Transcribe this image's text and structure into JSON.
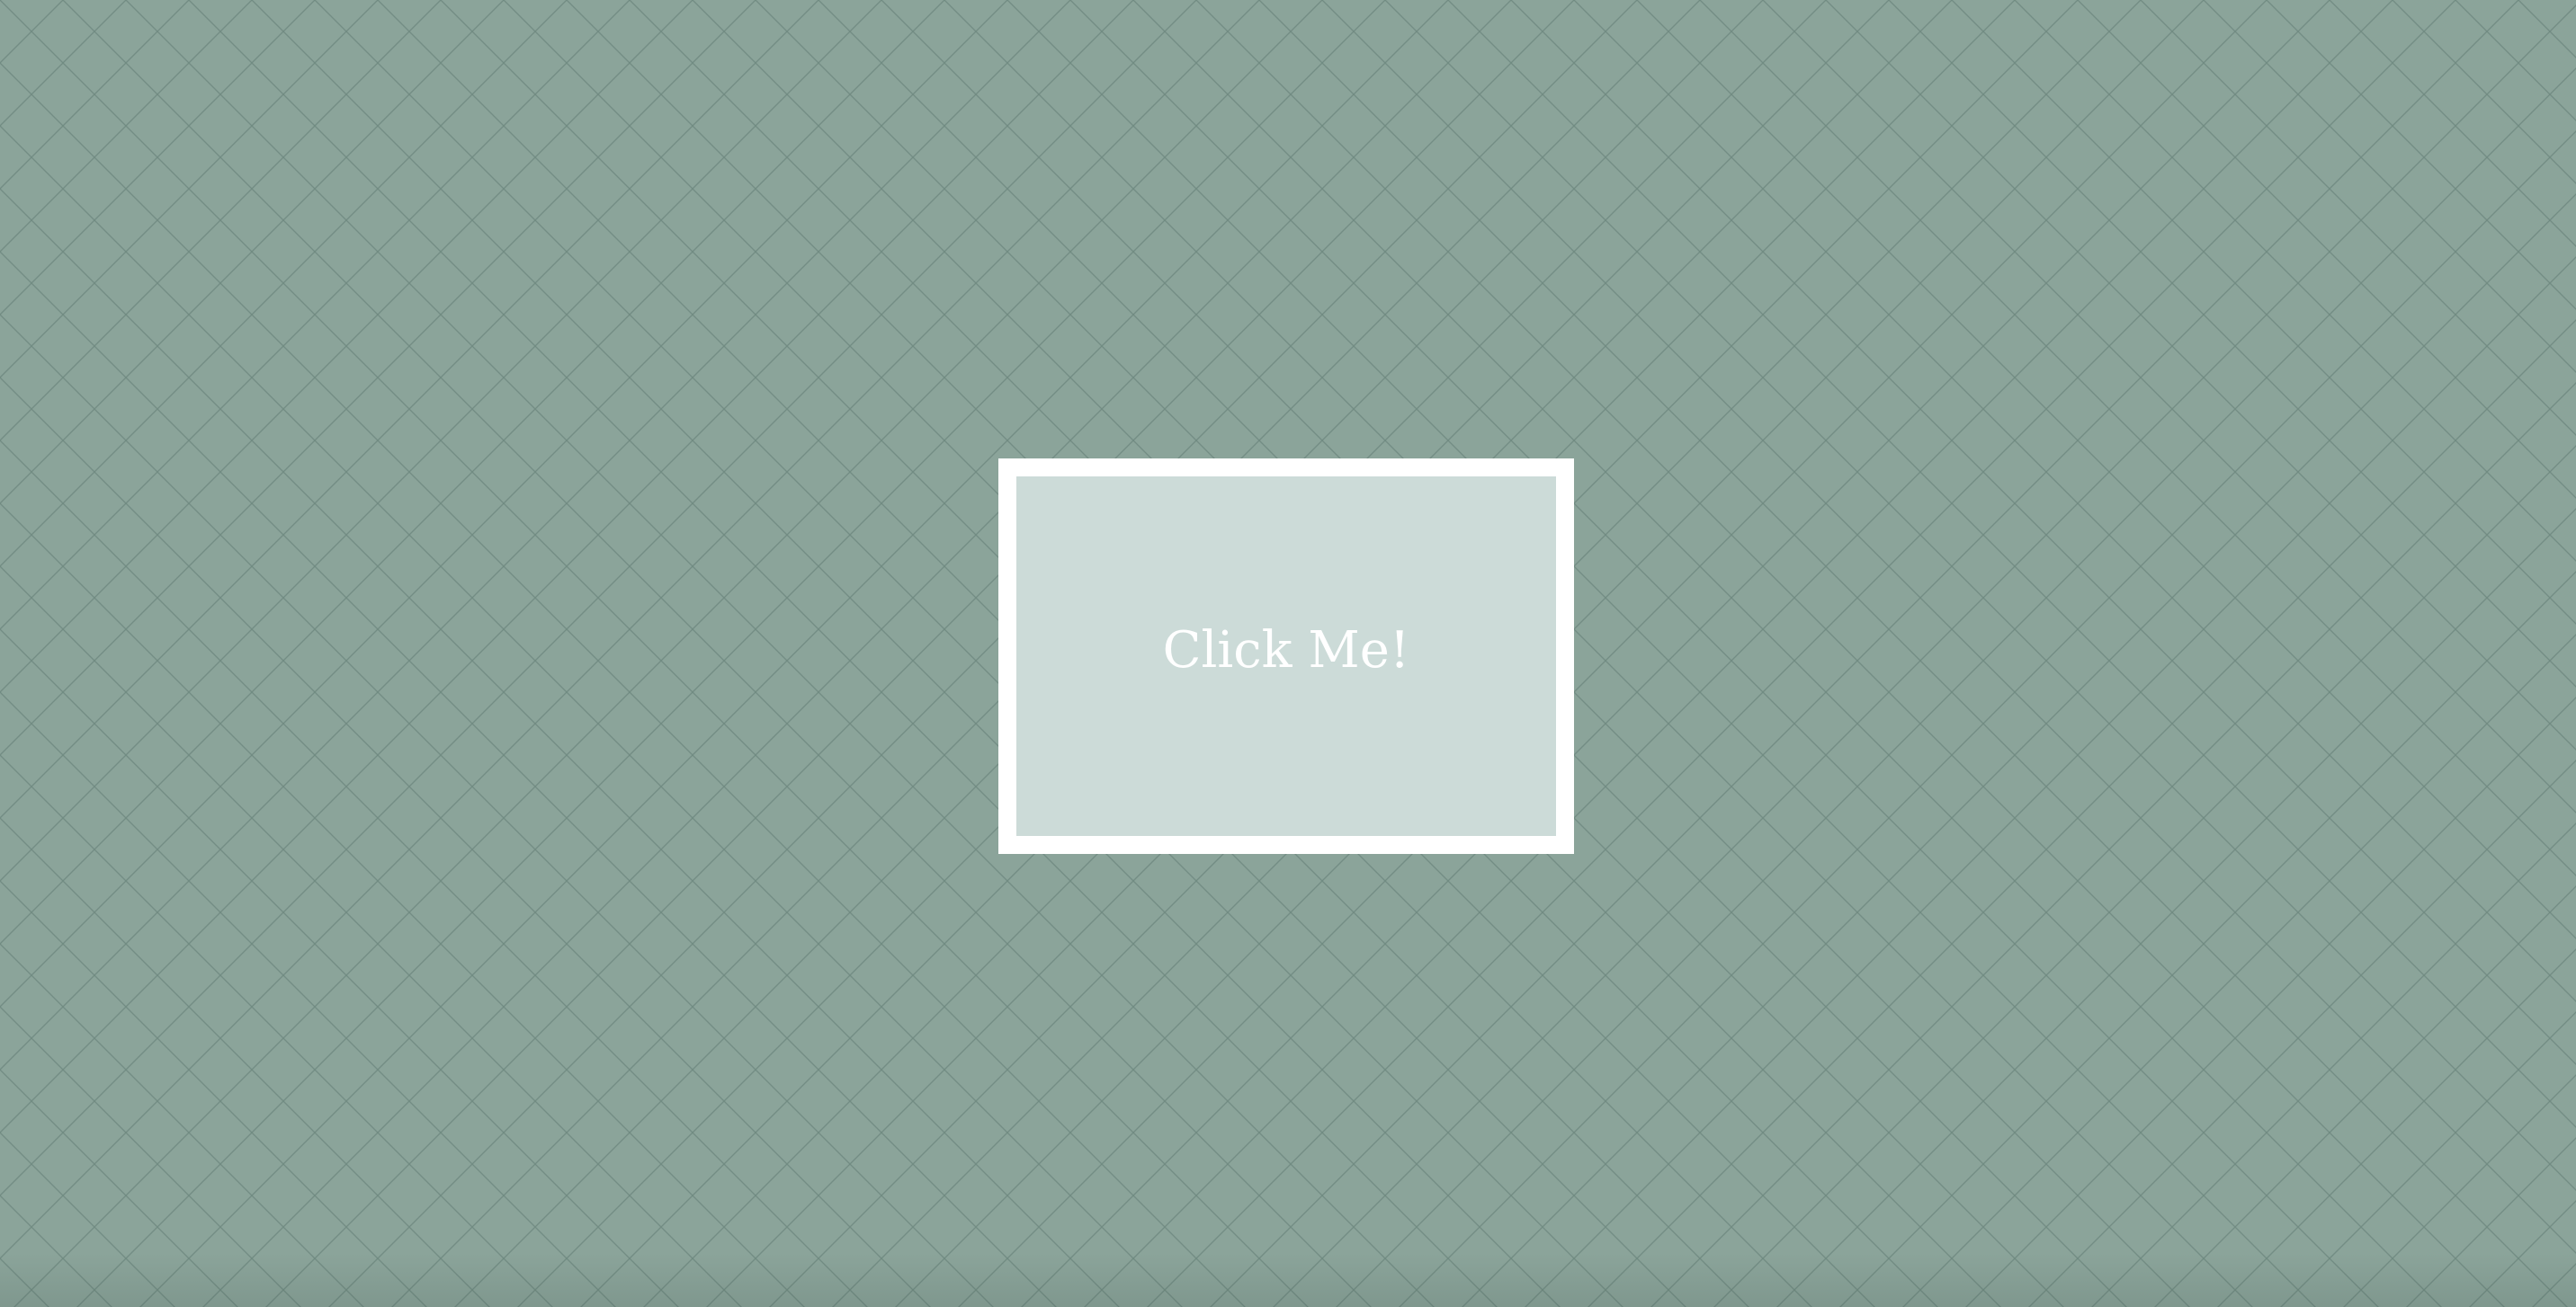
{
  "background": {
    "color": "#8ba49a",
    "pattern": "diagonal-crosshatch",
    "pattern_color": "#6f8a80"
  },
  "cta": {
    "label": "Click Me!",
    "frame_color": "#ffffff",
    "fill_color": "#ccdbd8",
    "text_color": "#ffffff"
  }
}
